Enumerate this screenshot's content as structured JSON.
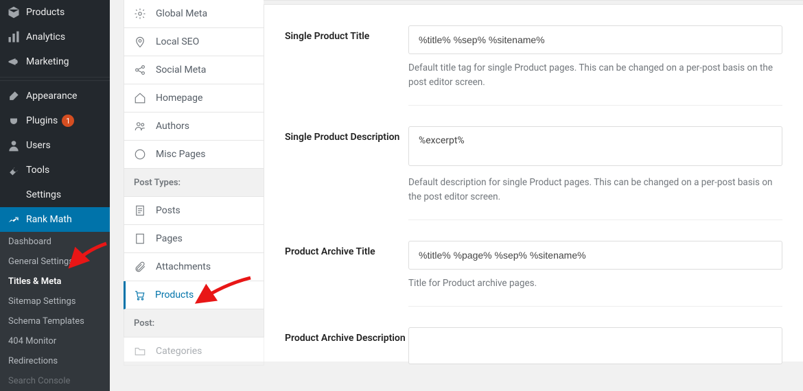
{
  "wp_sidebar": {
    "items_top": [
      {
        "label": "Products",
        "icon": "cube"
      },
      {
        "label": "Analytics",
        "icon": "bars"
      },
      {
        "label": "Marketing",
        "icon": "megaphone"
      }
    ],
    "items_mid": [
      {
        "label": "Appearance",
        "icon": "brush"
      },
      {
        "label": "Plugins",
        "icon": "plug",
        "badge": "1"
      },
      {
        "label": "Users",
        "icon": "user"
      },
      {
        "label": "Tools",
        "icon": "wrench"
      },
      {
        "label": "Settings",
        "icon": "sliders"
      }
    ],
    "rank_math_label": "Rank Math",
    "submenu": [
      "Dashboard",
      "General Settings",
      "Titles & Meta",
      "Sitemap Settings",
      "Schema Templates",
      "404 Monitor",
      "Redirections",
      "Search Console"
    ],
    "submenu_current_index": 2
  },
  "tabs": {
    "group1": [
      {
        "label": "Global Meta",
        "icon": "gear"
      },
      {
        "label": "Local SEO",
        "icon": "pin"
      },
      {
        "label": "Social Meta",
        "icon": "share"
      },
      {
        "label": "Homepage",
        "icon": "home"
      },
      {
        "label": "Authors",
        "icon": "users"
      },
      {
        "label": "Misc Pages",
        "icon": "more"
      }
    ],
    "group2_header": "Post Types:",
    "group2": [
      {
        "label": "Posts",
        "icon": "post"
      },
      {
        "label": "Pages",
        "icon": "page"
      },
      {
        "label": "Attachments",
        "icon": "clip"
      },
      {
        "label": "Products",
        "icon": "cart",
        "active": true
      }
    ],
    "group3_header": "Post:",
    "group3": [
      {
        "label": "Categories",
        "icon": "folder"
      }
    ]
  },
  "fields": {
    "single_title": {
      "label": "Single Product Title",
      "value": "%title% %sep% %sitename%",
      "help": "Default title tag for single Product pages. This can be changed on a per-post basis on the post editor screen."
    },
    "single_desc": {
      "label": "Single Product Description",
      "value": "%excerpt%",
      "help": "Default description for single Product pages. This can be changed on a per-post basis on the post editor screen."
    },
    "archive_title": {
      "label": "Product Archive Title",
      "value": "%title% %page% %sep% %sitename%",
      "help": "Title for Product archive pages."
    },
    "archive_desc": {
      "label": "Product Archive Description"
    }
  }
}
